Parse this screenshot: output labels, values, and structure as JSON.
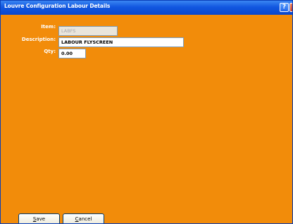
{
  "window": {
    "title": "Louvre Configuration Labour Details",
    "help_glyph": "?",
    "close_glyph": "×"
  },
  "form": {
    "item_label": "Item:",
    "item_value": "LABFS",
    "description_label": "Description:",
    "description_value": "LABOUR FLYSCREEN",
    "qty_label": "Qty:",
    "qty_value": "0.00"
  },
  "buttons": {
    "save_first": "S",
    "save_rest": "ave",
    "cancel_first": "C",
    "cancel_rest": "ancel"
  },
  "colors": {
    "background": "#f28c0a",
    "titlebar": "#1257e0"
  }
}
